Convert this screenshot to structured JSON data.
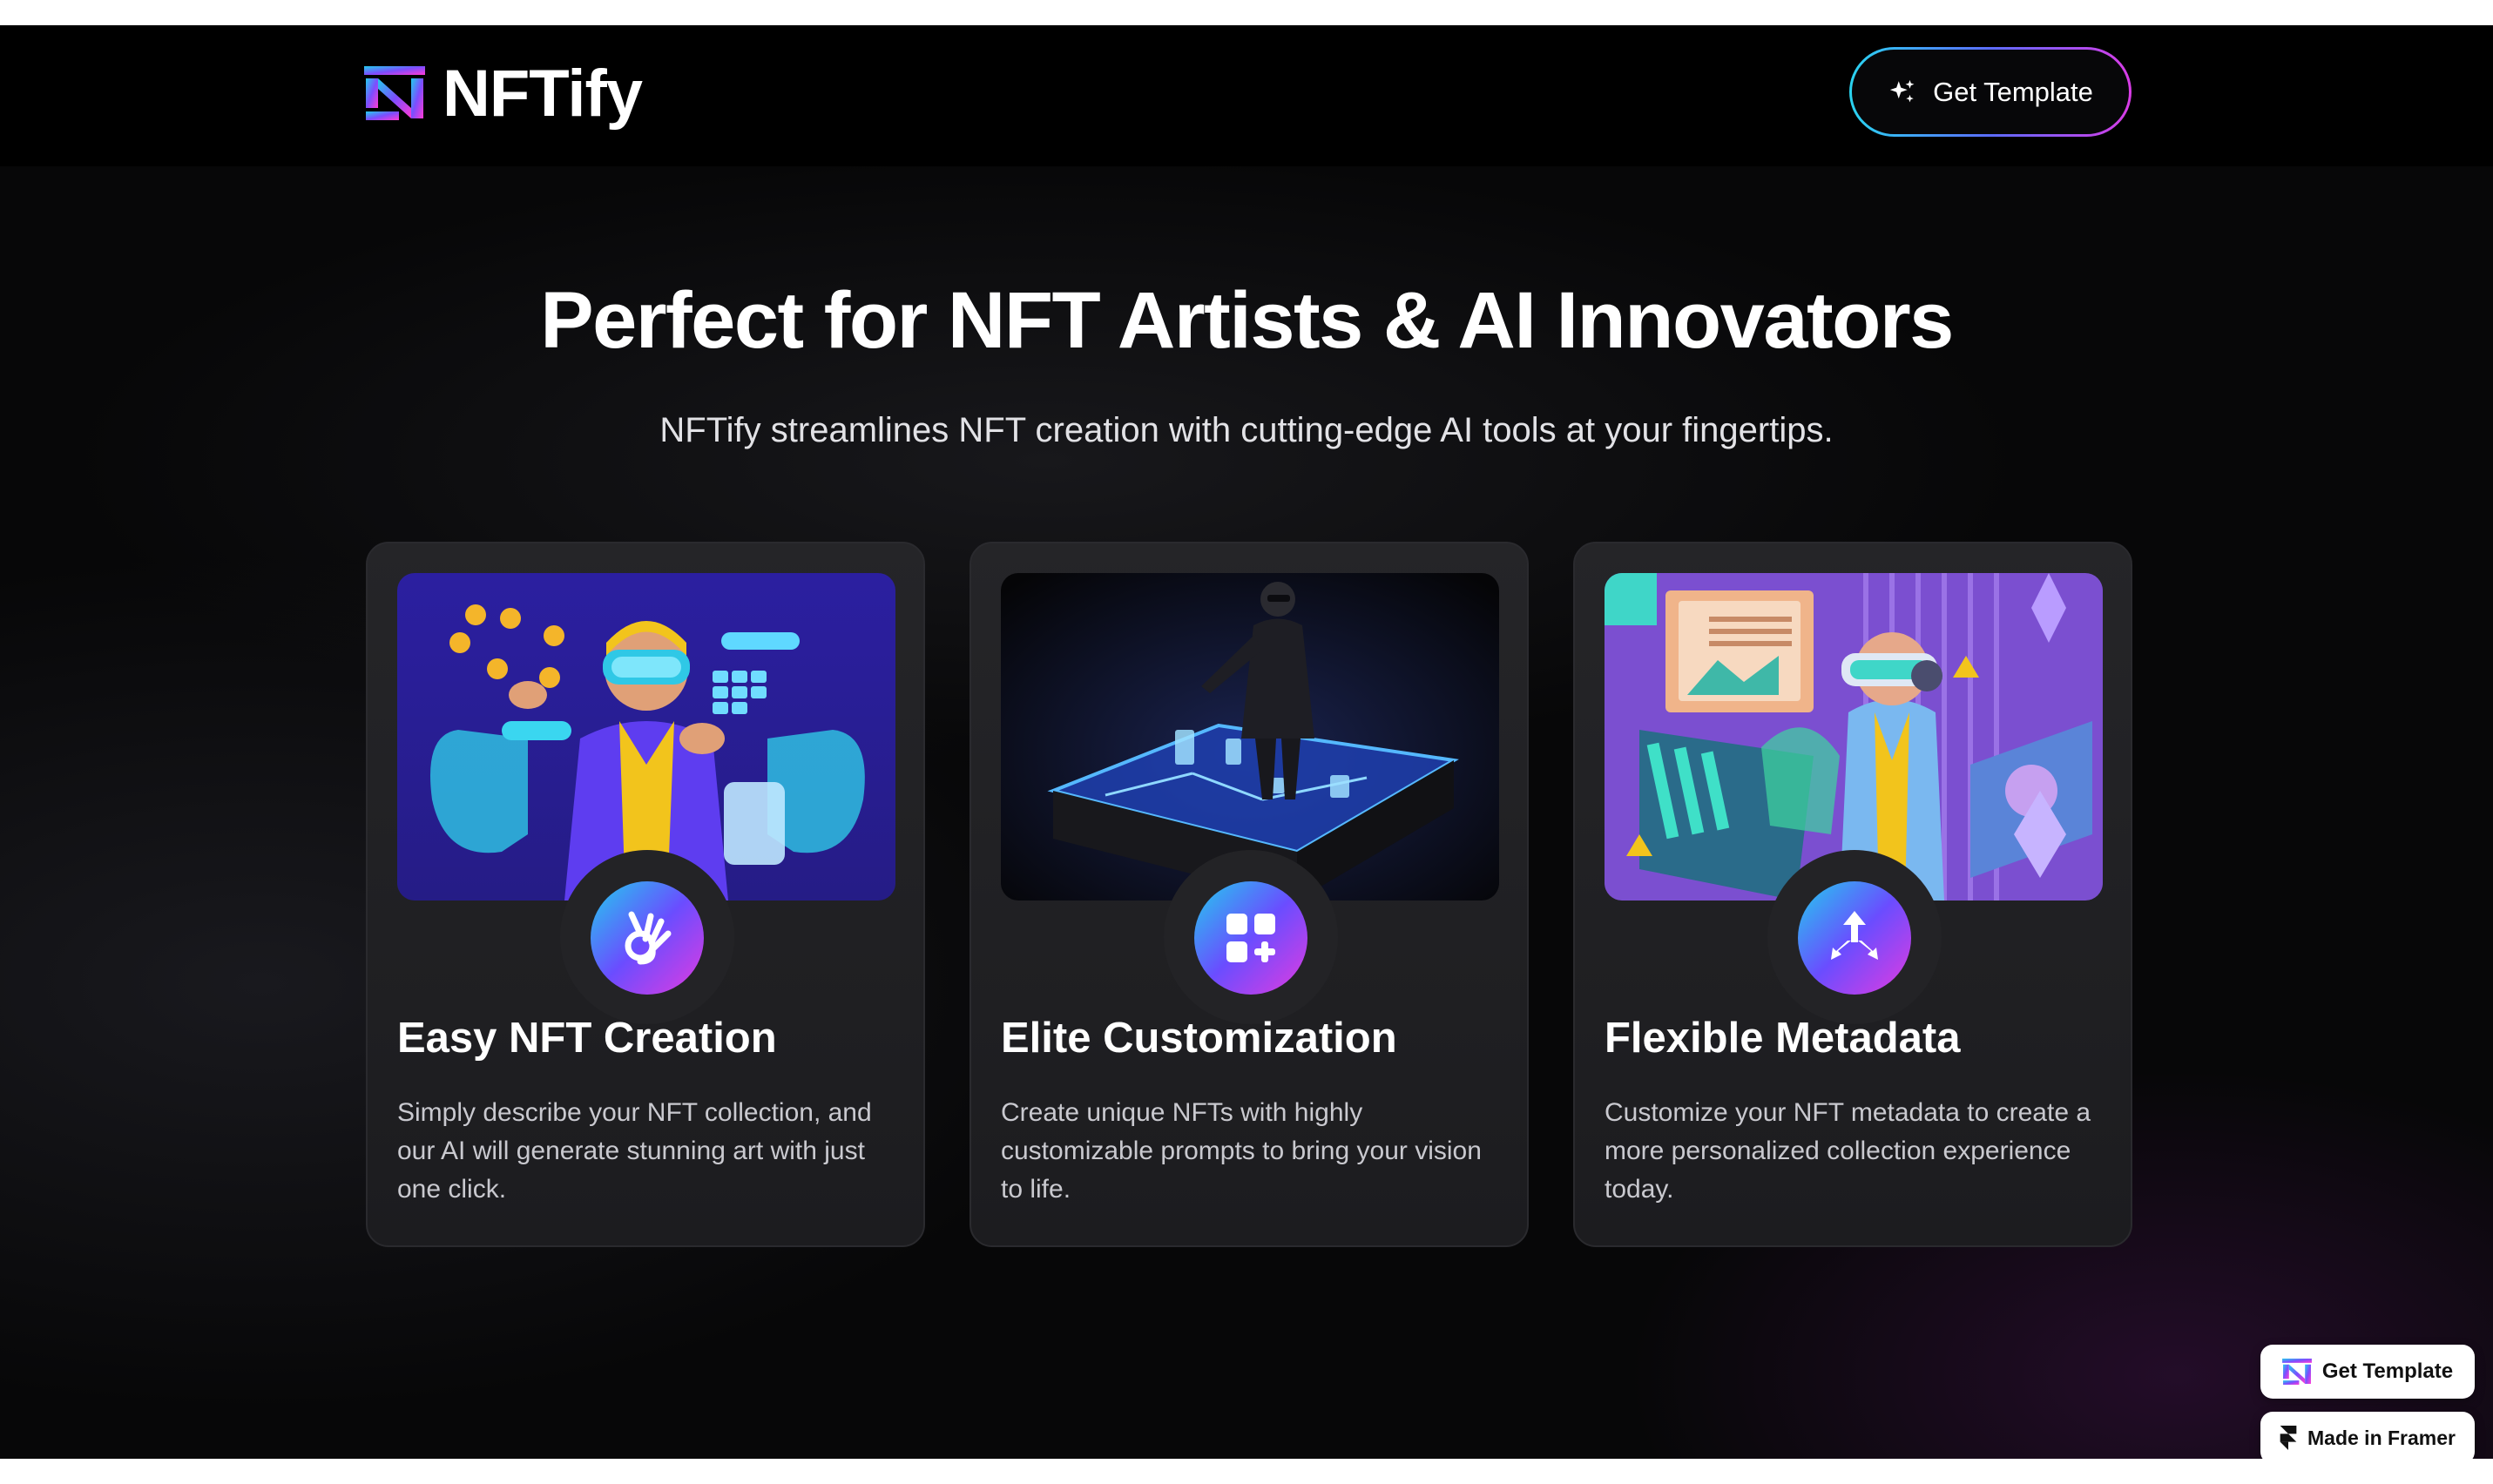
{
  "brand": {
    "name": "NFTify",
    "gradient_start": "#22cdee",
    "gradient_mid": "#6a4dff",
    "gradient_end": "#e23be0"
  },
  "navbar": {
    "cta_label": "Get Template",
    "cta_icon": "sparkle-icon"
  },
  "hero": {
    "title": "Perfect for NFT Artists & AI Innovators",
    "subtitle": "NFTify streamlines NFT creation with cutting-edge AI tools at your fingertips."
  },
  "features": [
    {
      "title": "Easy NFT Creation",
      "description": "Simply describe your NFT collection, and our AI will generate stunning art with just one click.",
      "icon": "ok-hand-icon",
      "image": "vr-user-holographic-interface"
    },
    {
      "title": "Elite Customization",
      "description": "Create unique NFTs with highly customizable prompts to bring your vision to life.",
      "icon": "widgets-add-icon",
      "image": "man-over-glowing-hologram-table"
    },
    {
      "title": "Flexible Metadata",
      "description": "Customize your NFT metadata to create a more personalized collection experience today.",
      "icon": "split-arrows-icon",
      "image": "vr-user-data-panels"
    }
  ],
  "floating": {
    "get_template_label": "Get Template",
    "made_in_framer_label": "Made in Framer",
    "framer_icon": "framer-logo-icon"
  }
}
